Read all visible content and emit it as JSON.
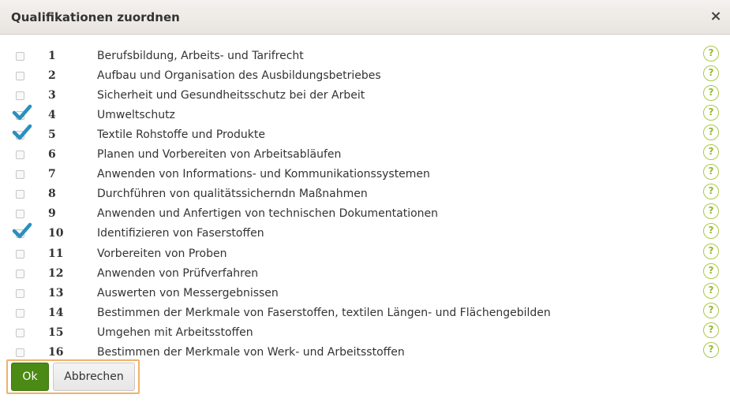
{
  "dialog": {
    "title": "Qualifikationen zuordnen",
    "close_glyph": "×",
    "help_glyph": "?",
    "ok_label": "Ok",
    "cancel_label": "Abbrechen",
    "colors": {
      "check": "#2a8fbd",
      "ok_button": "#4b8a15",
      "help_ring": "#a9c94a",
      "focus_outline": "#f0b26a"
    },
    "items": [
      {
        "num": "1",
        "label": "Berufsbildung, Arbeits- und Tarifrecht",
        "checked": false
      },
      {
        "num": "2",
        "label": "Aufbau und Organisation des Ausbildungsbetriebes",
        "checked": false
      },
      {
        "num": "3",
        "label": "Sicherheit und Gesundheitsschutz bei der Arbeit",
        "checked": false
      },
      {
        "num": "4",
        "label": "Umweltschutz",
        "checked": true
      },
      {
        "num": "5",
        "label": "Textile Rohstoffe und Produkte",
        "checked": true
      },
      {
        "num": "6",
        "label": "Planen und Vorbereiten von Arbeitsabläufen",
        "checked": false
      },
      {
        "num": "7",
        "label": "Anwenden von Informations- und Kommunikationssystemen",
        "checked": false
      },
      {
        "num": "8",
        "label": "Durchführen von qualitätssicherndn Maßnahmen",
        "checked": false
      },
      {
        "num": "9",
        "label": "Anwenden und Anfertigen von technischen Dokumentationen",
        "checked": false
      },
      {
        "num": "10",
        "label": "Identifizieren von Faserstoffen",
        "checked": true
      },
      {
        "num": "11",
        "label": "Vorbereiten von Proben",
        "checked": false
      },
      {
        "num": "12",
        "label": "Anwenden von Prüfverfahren",
        "checked": false
      },
      {
        "num": "13",
        "label": "Auswerten von Messergebnissen",
        "checked": false
      },
      {
        "num": "14",
        "label": "Bestimmen der Merkmale von Faserstoffen, textilen Längen- und Flächengebilden",
        "checked": false
      },
      {
        "num": "15",
        "label": "Umgehen mit Arbeitsstoffen",
        "checked": false
      },
      {
        "num": "16",
        "label": "Bestimmen der Merkmale von Werk- und Arbeitsstoffen",
        "checked": false
      }
    ]
  }
}
